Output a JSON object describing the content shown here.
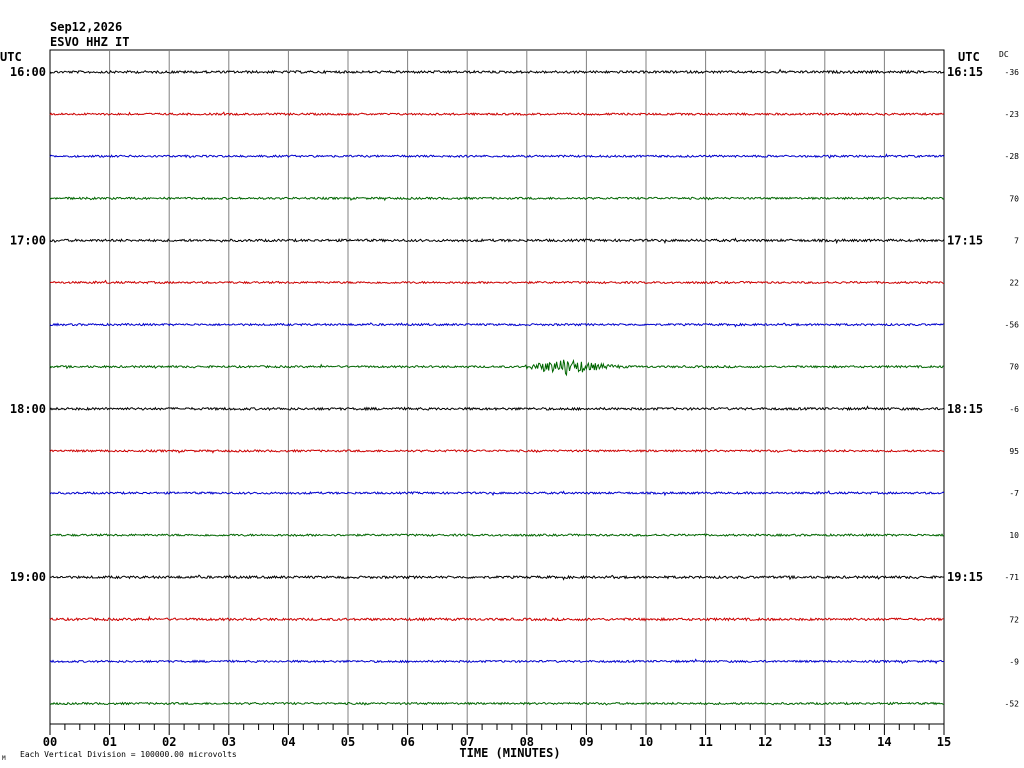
{
  "header": {
    "date": "Sep12,2026",
    "station": "ESVO HHZ IT"
  },
  "left_axis_label": "UTC",
  "right_axis_label": "UTC",
  "dc_label": "DC",
  "footer_note": "Each Vertical Division = 100000.00 microvolts",
  "footer_mark": "M",
  "chart_data": {
    "type": "line",
    "subtype": "helicorder",
    "xlabel": "TIME (MINUTES)",
    "xlim": [
      0,
      15
    ],
    "x_ticks": [
      "00",
      "01",
      "02",
      "03",
      "04",
      "05",
      "06",
      "07",
      "08",
      "09",
      "10",
      "11",
      "12",
      "13",
      "14",
      "15"
    ],
    "minor_ticks_per_minute": 4,
    "grid": true,
    "line_colors": [
      "#000000",
      "#cc0000",
      "#0000cc",
      "#006600"
    ],
    "left_time_labels": [
      {
        "trace_index": 0,
        "label": "16:00"
      },
      {
        "trace_index": 4,
        "label": "17:00"
      },
      {
        "trace_index": 8,
        "label": "18:00"
      },
      {
        "trace_index": 12,
        "label": "19:00"
      }
    ],
    "right_time_labels": [
      {
        "trace_index": 0,
        "label": "16:15"
      },
      {
        "trace_index": 4,
        "label": "17:15"
      },
      {
        "trace_index": 8,
        "label": "18:15"
      },
      {
        "trace_index": 12,
        "label": "19:15"
      }
    ],
    "dc_offsets": [
      "-36",
      "-23",
      "-28",
      "70",
      "7",
      "22",
      "-56",
      "70",
      "-6",
      "95",
      "-7",
      "10",
      "-71",
      "72",
      "-9",
      "-52"
    ],
    "traces": [
      {
        "amplitude": 1.2
      },
      {
        "amplitude": 1.0
      },
      {
        "amplitude": 1.0
      },
      {
        "amplitude": 1.0
      },
      {
        "amplitude": 1.2
      },
      {
        "amplitude": 1.0
      },
      {
        "amplitude": 1.0
      },
      {
        "amplitude": 1.0,
        "event": {
          "start_min": 7.8,
          "peak_min": 8.7,
          "end_min": 10.2,
          "peak_amplitude": 9
        }
      },
      {
        "amplitude": 1.2
      },
      {
        "amplitude": 1.0
      },
      {
        "amplitude": 1.0
      },
      {
        "amplitude": 1.0
      },
      {
        "amplitude": 1.2
      },
      {
        "amplitude": 1.2
      },
      {
        "amplitude": 1.0
      },
      {
        "amplitude": 1.0
      }
    ]
  }
}
